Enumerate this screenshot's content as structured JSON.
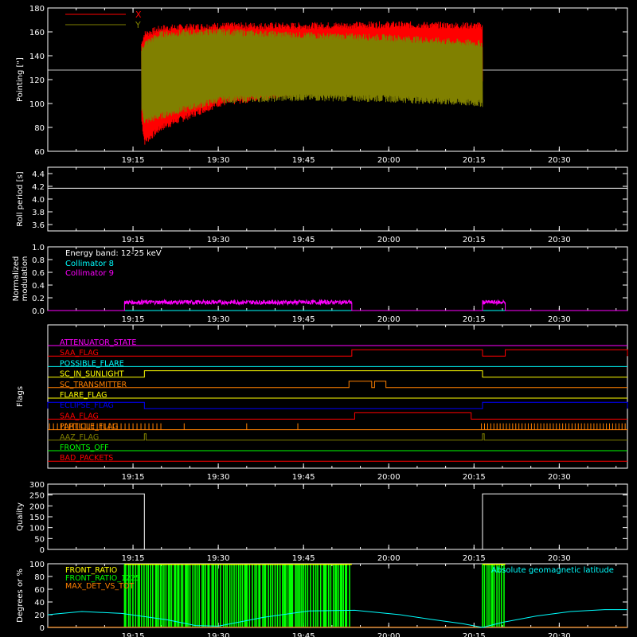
{
  "colors": {
    "background": "#000000",
    "axes": "#ffffff",
    "red": "#ff0000",
    "olive": "#808000",
    "magenta": "#ff00ff",
    "cyan": "#00ffff",
    "yellow": "#ffff00",
    "orange": "#ff8000",
    "blue": "#0000ff",
    "green": "#00ff00",
    "white": "#ffffff"
  },
  "time_axis": {
    "range_minutes": [
      1140,
      1182
    ],
    "ticks": [
      {
        "t": 1155,
        "label": "19:15"
      },
      {
        "t": 1170,
        "label": "19:30"
      },
      {
        "t": 1185,
        "label": "19:45"
      },
      {
        "t": 1200,
        "label": "20:00"
      },
      {
        "t": 1215,
        "label": "20:15"
      },
      {
        "t": 1230,
        "label": "20:30"
      }
    ]
  },
  "chart_data": [
    {
      "type": "line",
      "id": "pointing",
      "ylabel": "Pointing [\"]",
      "ylim": [
        60,
        180
      ],
      "yticks": [
        60,
        80,
        100,
        120,
        140,
        160,
        180
      ],
      "legend": [
        "X",
        "Y"
      ],
      "legend_position": "top-left",
      "series": [
        {
          "name": "X",
          "color": "red",
          "x": [
            1156.5,
            1157,
            1160,
            1170,
            1185,
            1200,
            1216.5
          ],
          "upper": [
            150,
            158,
            163,
            165,
            165,
            166,
            165
          ],
          "lower": [
            85,
            68,
            80,
            100,
            110,
            112,
            118
          ]
        },
        {
          "name": "Y",
          "color": "olive",
          "x": [
            1156.5,
            1157,
            1160,
            1170,
            1185,
            1200,
            1216.5
          ],
          "upper": [
            145,
            150,
            158,
            160,
            157,
            155,
            150
          ],
          "lower": [
            95,
            85,
            90,
            103,
            105,
            104,
            100
          ]
        }
      ],
      "reference_line": 128
    },
    {
      "type": "line",
      "id": "roll",
      "ylabel": "Roll period [s]",
      "ylim": [
        3.5,
        4.5
      ],
      "yticks": [
        3.6,
        3.8,
        4.0,
        4.2,
        4.4
      ],
      "series": [
        {
          "color": "white",
          "x": [
            1140,
            1242
          ],
          "y": [
            4.17,
            4.17
          ]
        }
      ]
    },
    {
      "type": "line",
      "id": "modulation",
      "ylabel": [
        "Normalized",
        "modulation"
      ],
      "ylim": [
        0,
        1.0
      ],
      "yticks": [
        0.0,
        0.2,
        0.4,
        0.6,
        0.8,
        1.0
      ],
      "annotation": "Energy band: 12-25 keV",
      "legend": [
        "Collimator 8",
        "Collimator 9"
      ],
      "legend_colors": [
        "cyan",
        "magenta"
      ],
      "series": [
        {
          "name": "Collimator 8",
          "color": "cyan",
          "x": [
            1140,
            1242
          ],
          "y": [
            0,
            0
          ]
        },
        {
          "name": "Collimator 9",
          "color": "magenta",
          "segments": [
            [
              1153.5,
              1193.5,
              0.13
            ],
            [
              1216.5,
              1220.5,
              0.13
            ]
          ]
        }
      ]
    },
    {
      "type": "step",
      "id": "flags",
      "ylabel": "Flags",
      "flags": [
        {
          "label": "ATTENUATOR_STATE",
          "color": "magenta",
          "highs": []
        },
        {
          "label": "SAA_FLAG",
          "color": "red",
          "highs": [
            [
              1193.5,
              1216.5
            ],
            [
              1220.5,
              1242
            ]
          ]
        },
        {
          "label": "POSSIBLE_FLARE",
          "color": "cyan",
          "highs": []
        },
        {
          "label": "SC_IN_SUNLIGHT",
          "color": "yellow",
          "highs": [
            [
              1157,
              1216.5
            ]
          ]
        },
        {
          "label": "SC_TRANSMITTER",
          "color": "orange",
          "highs": [
            [
              1193,
              1197
            ],
            [
              1197.5,
              1199.5
            ]
          ]
        },
        {
          "label": "FLARE_FLAG",
          "color": "yellow",
          "highs": []
        },
        {
          "label": "ECLIPSE_FLAG",
          "color": "blue",
          "highs": [
            [
              1140,
              1157
            ],
            [
              1216.5,
              1242
            ]
          ]
        },
        {
          "label": "SAA_FLAG",
          "color": "red",
          "highs": [
            [
              1194,
              1214.5
            ]
          ]
        },
        {
          "label": "PARTICLE_FLAG",
          "color": "orange",
          "highs": []
        },
        {
          "label": "AAZ_FLAG",
          "color": "olive",
          "highs": [
            [
              1157,
              1157.3
            ],
            [
              1216.5,
              1216.8
            ]
          ]
        },
        {
          "label": "FRONTS_OFF",
          "color": "green",
          "highs": []
        },
        {
          "label": "BAD_PACKETS",
          "color": "red",
          "highs": []
        }
      ]
    },
    {
      "type": "step",
      "id": "quality",
      "ylabel": "Quality",
      "ylim": [
        0,
        300
      ],
      "yticks": [
        0,
        50,
        100,
        150,
        200,
        250,
        300
      ],
      "series": [
        {
          "color": "white",
          "x": [
            1140,
            1157,
            1157,
            1216.5,
            1216.5,
            1242
          ],
          "y": [
            255,
            255,
            0,
            0,
            255,
            255
          ]
        }
      ]
    },
    {
      "type": "line",
      "id": "ratios",
      "ylabel": "Degrees or %",
      "ylim": [
        0,
        100
      ],
      "yticks": [
        0,
        20,
        40,
        60,
        80,
        100
      ],
      "legend": [
        "FRONT_RATIO",
        "FRONT_RATIO_1225",
        "MAX_DET_VS_TOT"
      ],
      "legend_colors": [
        "yellow",
        "green",
        "orange"
      ],
      "right_legend": "Absolute geomagnetic latitude",
      "green_bursts": [
        [
          1153.5,
          1193.5
        ],
        [
          1216.5,
          1220.5
        ]
      ],
      "latitude": {
        "color": "cyan",
        "x": [
          1140,
          1146,
          1153,
          1161,
          1166,
          1170,
          1178,
          1186,
          1194,
          1202,
          1208,
          1213,
          1216.5,
          1220,
          1226,
          1232,
          1238,
          1242
        ],
        "y": [
          20,
          25,
          22,
          12,
          3,
          2,
          16,
          26,
          27,
          20,
          12,
          6,
          0,
          8,
          18,
          25,
          28,
          28
        ]
      }
    }
  ]
}
